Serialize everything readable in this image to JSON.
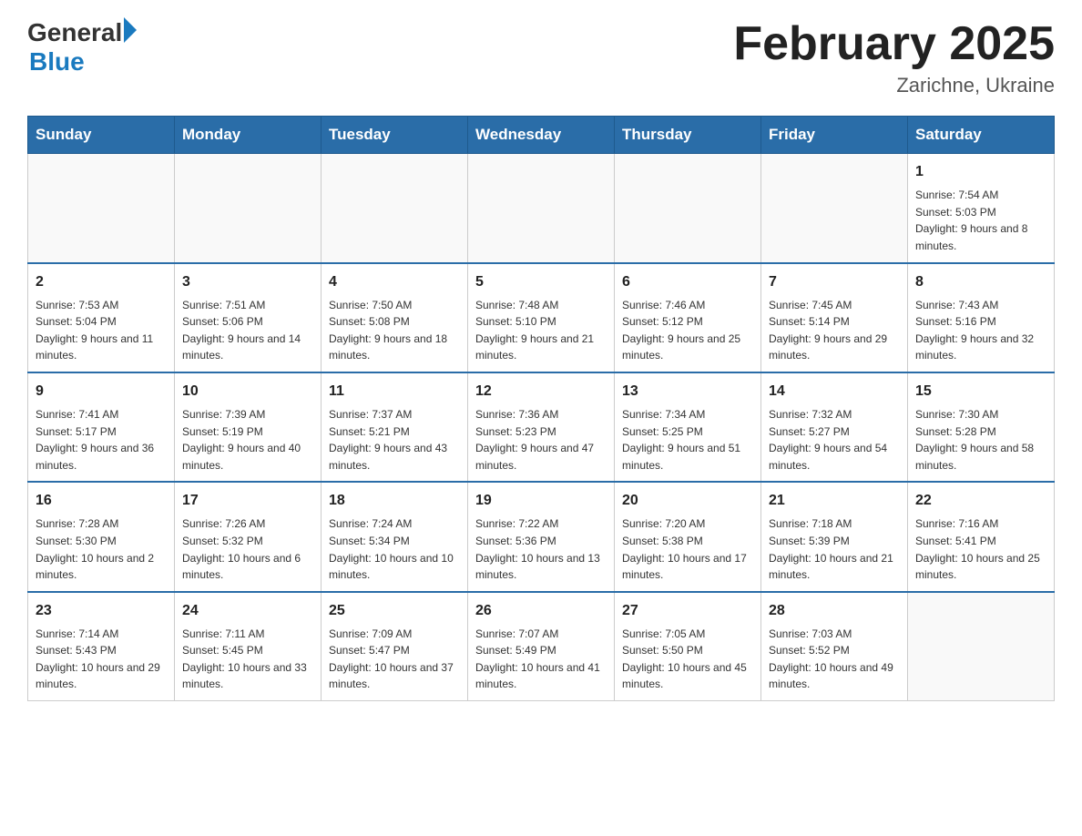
{
  "header": {
    "logo_general": "General",
    "logo_blue": "Blue",
    "month_title": "February 2025",
    "location": "Zarichne, Ukraine"
  },
  "days_of_week": [
    "Sunday",
    "Monday",
    "Tuesday",
    "Wednesday",
    "Thursday",
    "Friday",
    "Saturday"
  ],
  "weeks": [
    {
      "days": [
        {
          "date": "",
          "info": ""
        },
        {
          "date": "",
          "info": ""
        },
        {
          "date": "",
          "info": ""
        },
        {
          "date": "",
          "info": ""
        },
        {
          "date": "",
          "info": ""
        },
        {
          "date": "",
          "info": ""
        },
        {
          "date": "1",
          "info": "Sunrise: 7:54 AM\nSunset: 5:03 PM\nDaylight: 9 hours and 8 minutes."
        }
      ]
    },
    {
      "days": [
        {
          "date": "2",
          "info": "Sunrise: 7:53 AM\nSunset: 5:04 PM\nDaylight: 9 hours and 11 minutes."
        },
        {
          "date": "3",
          "info": "Sunrise: 7:51 AM\nSunset: 5:06 PM\nDaylight: 9 hours and 14 minutes."
        },
        {
          "date": "4",
          "info": "Sunrise: 7:50 AM\nSunset: 5:08 PM\nDaylight: 9 hours and 18 minutes."
        },
        {
          "date": "5",
          "info": "Sunrise: 7:48 AM\nSunset: 5:10 PM\nDaylight: 9 hours and 21 minutes."
        },
        {
          "date": "6",
          "info": "Sunrise: 7:46 AM\nSunset: 5:12 PM\nDaylight: 9 hours and 25 minutes."
        },
        {
          "date": "7",
          "info": "Sunrise: 7:45 AM\nSunset: 5:14 PM\nDaylight: 9 hours and 29 minutes."
        },
        {
          "date": "8",
          "info": "Sunrise: 7:43 AM\nSunset: 5:16 PM\nDaylight: 9 hours and 32 minutes."
        }
      ]
    },
    {
      "days": [
        {
          "date": "9",
          "info": "Sunrise: 7:41 AM\nSunset: 5:17 PM\nDaylight: 9 hours and 36 minutes."
        },
        {
          "date": "10",
          "info": "Sunrise: 7:39 AM\nSunset: 5:19 PM\nDaylight: 9 hours and 40 minutes."
        },
        {
          "date": "11",
          "info": "Sunrise: 7:37 AM\nSunset: 5:21 PM\nDaylight: 9 hours and 43 minutes."
        },
        {
          "date": "12",
          "info": "Sunrise: 7:36 AM\nSunset: 5:23 PM\nDaylight: 9 hours and 47 minutes."
        },
        {
          "date": "13",
          "info": "Sunrise: 7:34 AM\nSunset: 5:25 PM\nDaylight: 9 hours and 51 minutes."
        },
        {
          "date": "14",
          "info": "Sunrise: 7:32 AM\nSunset: 5:27 PM\nDaylight: 9 hours and 54 minutes."
        },
        {
          "date": "15",
          "info": "Sunrise: 7:30 AM\nSunset: 5:28 PM\nDaylight: 9 hours and 58 minutes."
        }
      ]
    },
    {
      "days": [
        {
          "date": "16",
          "info": "Sunrise: 7:28 AM\nSunset: 5:30 PM\nDaylight: 10 hours and 2 minutes."
        },
        {
          "date": "17",
          "info": "Sunrise: 7:26 AM\nSunset: 5:32 PM\nDaylight: 10 hours and 6 minutes."
        },
        {
          "date": "18",
          "info": "Sunrise: 7:24 AM\nSunset: 5:34 PM\nDaylight: 10 hours and 10 minutes."
        },
        {
          "date": "19",
          "info": "Sunrise: 7:22 AM\nSunset: 5:36 PM\nDaylight: 10 hours and 13 minutes."
        },
        {
          "date": "20",
          "info": "Sunrise: 7:20 AM\nSunset: 5:38 PM\nDaylight: 10 hours and 17 minutes."
        },
        {
          "date": "21",
          "info": "Sunrise: 7:18 AM\nSunset: 5:39 PM\nDaylight: 10 hours and 21 minutes."
        },
        {
          "date": "22",
          "info": "Sunrise: 7:16 AM\nSunset: 5:41 PM\nDaylight: 10 hours and 25 minutes."
        }
      ]
    },
    {
      "days": [
        {
          "date": "23",
          "info": "Sunrise: 7:14 AM\nSunset: 5:43 PM\nDaylight: 10 hours and 29 minutes."
        },
        {
          "date": "24",
          "info": "Sunrise: 7:11 AM\nSunset: 5:45 PM\nDaylight: 10 hours and 33 minutes."
        },
        {
          "date": "25",
          "info": "Sunrise: 7:09 AM\nSunset: 5:47 PM\nDaylight: 10 hours and 37 minutes."
        },
        {
          "date": "26",
          "info": "Sunrise: 7:07 AM\nSunset: 5:49 PM\nDaylight: 10 hours and 41 minutes."
        },
        {
          "date": "27",
          "info": "Sunrise: 7:05 AM\nSunset: 5:50 PM\nDaylight: 10 hours and 45 minutes."
        },
        {
          "date": "28",
          "info": "Sunrise: 7:03 AM\nSunset: 5:52 PM\nDaylight: 10 hours and 49 minutes."
        },
        {
          "date": "",
          "info": ""
        }
      ]
    }
  ]
}
